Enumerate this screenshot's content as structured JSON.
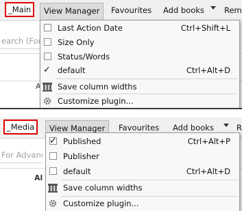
{
  "panel1": {
    "toolbar": {
      "main_label": "_Main",
      "view_manager_label": "View Manager",
      "favourites_label": "Favourites",
      "add_books_label": "Add books",
      "overflow_label": "Rem"
    },
    "search_placeholder": "earch (For",
    "column_fragment": "A",
    "menu": {
      "items": [
        {
          "label": "Last Action Date",
          "shortcut": "Ctrl+Shift+L",
          "checked": false
        },
        {
          "label": "Size Only",
          "shortcut": "",
          "checked": false
        },
        {
          "label": "Status/Words",
          "shortcut": "",
          "checked": false
        },
        {
          "label": "default",
          "shortcut": "Ctrl+Alt+D",
          "checked": true
        }
      ],
      "save_widths_label": "Save column widths",
      "customize_label": "Customize plugin..."
    }
  },
  "panel2": {
    "toolbar": {
      "main_label": "_Media",
      "view_manager_label": "View Manager",
      "favourites_label": "Favourites",
      "add_books_label": "Add books",
      "overflow_label": "Re"
    },
    "search_placeholder": "For Advanc",
    "column_fragment": "Al",
    "menu": {
      "items": [
        {
          "label": "Published",
          "shortcut": "Ctrl+Alt+P",
          "checked": true
        },
        {
          "label": "Publisher",
          "shortcut": "",
          "checked": false
        },
        {
          "label": "default",
          "shortcut": "Ctrl+Alt+D",
          "checked": false
        }
      ],
      "save_widths_label": "Save column widths",
      "customize_label": "Customize plugin..."
    }
  },
  "colors": {
    "highlight_border": "#e00000",
    "menu_bg": "#f8f8f8"
  }
}
